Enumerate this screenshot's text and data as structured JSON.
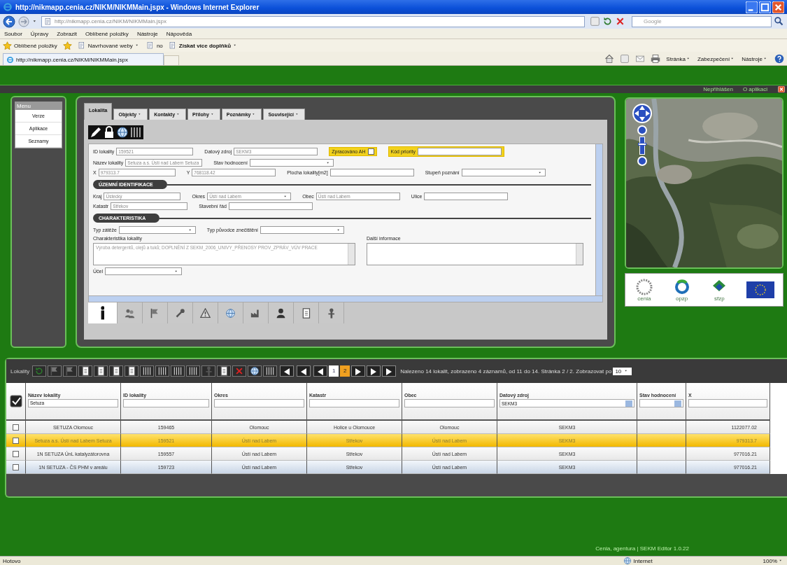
{
  "window": {
    "title": "http://nikmapp.cenia.cz/NIKM/NIKMMain.jspx - Windows Internet Explorer"
  },
  "address_bar": {
    "url": "http://nikmapp.cenia.cz/NIKM/NIKMMain.jspx",
    "search_placeholder": "Google"
  },
  "menu_bar": [
    "Soubor",
    "Úpravy",
    "Zobrazit",
    "Oblíbené položky",
    "Nástroje",
    "Nápověda"
  ],
  "favorites_bar": {
    "label": "Oblíbené položky",
    "items": [
      {
        "label": "Navrhované weby",
        "dropdown": true,
        "bold": false
      },
      {
        "label": "no",
        "dropdown": false,
        "bold": false
      },
      {
        "label": "Získat více doplňků",
        "dropdown": true,
        "bold": true
      }
    ]
  },
  "browser_tab": {
    "title": "http://nikmapp.cenia.cz/NIKM/NIKMMain.jspx"
  },
  "command_bar": [
    "Stránka",
    "Zabezpečení",
    "Nástroje"
  ],
  "app": {
    "header": {
      "user": "Nepřihlášen",
      "link": "O aplikaci"
    },
    "menu": {
      "title": "Menu",
      "items": [
        {
          "label": "Verze",
          "selected": false
        },
        {
          "label": "Aplikace",
          "selected": false
        },
        {
          "label": "Seznamy",
          "selected": false
        }
      ]
    },
    "form": {
      "tabs": [
        {
          "label": "Lokalita",
          "selected": true
        },
        {
          "label": "Objekty",
          "selected": false
        },
        {
          "label": "Kontakty",
          "selected": false
        },
        {
          "label": "Přílohy",
          "selected": false
        },
        {
          "label": "Poznámky",
          "selected": false
        },
        {
          "label": "Související",
          "selected": false
        }
      ],
      "sections": [
        {
          "rows": [
            [
              {
                "kind": "text",
                "label": "ID lokality",
                "value": "159521",
                "highlighted": false
              },
              {
                "kind": "text",
                "label": "Datový zdroj",
                "value": "SEKM3",
                "highlighted": false
              },
              {
                "kind": "checkbox",
                "label": "Zpracováno AH",
                "checked": false,
                "highlighted": true
              },
              {
                "kind": "text",
                "label": "Kód priority",
                "highlighted": true
              }
            ],
            [
              {
                "kind": "text",
                "label": "Název lokality",
                "value": "Setuza a.s. Ústí nad Labem Setuza",
                "highlighted": false
              },
              {
                "kind": "select",
                "label": "Stav hodnocení",
                "highlighted": false
              }
            ],
            [
              {
                "kind": "text",
                "label": "X",
                "value": "979313.7",
                "highlighted": false
              },
              {
                "kind": "text",
                "label": "Y",
                "value": "768118.42",
                "highlighted": false
              },
              {
                "kind": "text",
                "label": "Plocha lokality[m2]",
                "highlighted": false
              },
              {
                "kind": "select",
                "label": "Stupeň poznání",
                "highlighted": false
              }
            ]
          ]
        },
        {
          "title": "ÚZEMNÍ IDENTIFIKACE",
          "rows": [
            [
              {
                "kind": "text",
                "label": "Kraj",
                "value": "Ústecký",
                "highlighted": false
              },
              {
                "kind": "select",
                "label": "Okres",
                "value": "Ústí nad Labem",
                "highlighted": false
              },
              {
                "kind": "text",
                "label": "Obec",
                "value": "Ústí nad Labem",
                "highlighted": false
              },
              {
                "kind": "text",
                "label": "Ulice",
                "highlighted": false
              }
            ],
            [
              {
                "kind": "text",
                "label": "Katastr",
                "value": "Střekov",
                "highlighted": false
              },
              {
                "kind": "text",
                "label": "Stavební řád",
                "highlighted": false
              }
            ]
          ]
        },
        {
          "title": "CHARAKTERISTIKA",
          "rows": [
            [
              {
                "kind": "select",
                "label": "Typ zátěže",
                "highlighted": false
              },
              {
                "kind": "select",
                "label": "Typ původce znečištění",
                "highlighted": false
              }
            ],
            [
              {
                "kind": "textarea",
                "label": "Charakteristika lokality",
                "value": "Výroba detergentů, olejů a tuků; DOPLNĚNÍ Z SEKM_2006_UNIVY_PŘENOSY PROV_ZPRÁV_VÚV PRACE",
                "highlighted": false
              },
              {
                "kind": "textarea",
                "label": "Další informace",
                "highlighted": false
              }
            ],
            [
              {
                "kind": "select",
                "label": "Účel",
                "highlighted": false
              }
            ]
          ]
        }
      ],
      "icon_tabs": [
        {
          "selected": true
        },
        {
          "selected": false
        },
        {
          "selected": false
        },
        {
          "selected": false
        },
        {
          "selected": false
        },
        {
          "selected": false
        },
        {
          "selected": false
        },
        {
          "selected": false
        },
        {
          "selected": false
        },
        {
          "selected": false
        }
      ]
    },
    "logos": [
      {
        "kind": "cenia",
        "caption": "cenia"
      },
      {
        "kind": "ring",
        "caption": "opzp"
      },
      {
        "kind": "diamond",
        "caption": "sfzp"
      },
      {
        "kind": "eu"
      }
    ],
    "map_zoom": {
      "level": 0.6
    },
    "grid": {
      "label": "Lokality",
      "pages": [
        {
          "label": "1",
          "selected": false
        },
        {
          "label": "2",
          "selected": true
        }
      ],
      "pager_text": "Nalezeno 14 lokalit, zobrazeno 4 záznamů, od 11 do 14. Stránka 2 / 2. Zobrazovat po",
      "page_size": "10",
      "header_checked": true,
      "columns": [
        {
          "label": "Název lokality",
          "filter": {
            "kind": "text",
            "value": "Setuza"
          }
        },
        {
          "label": "ID lokality",
          "filter": {
            "kind": "text"
          }
        },
        {
          "label": "Okres",
          "filter": {
            "kind": "text"
          }
        },
        {
          "label": "Katastr",
          "filter": {
            "kind": "text"
          }
        },
        {
          "label": "Obec",
          "filter": {
            "kind": "text"
          }
        },
        {
          "label": "Datový zdroj",
          "filter": {
            "kind": "select",
            "value": "SEKM3"
          }
        },
        {
          "label": "Stav hodnocení",
          "filter": {
            "kind": "select"
          }
        },
        {
          "label": "X",
          "filter": {
            "kind": "text"
          }
        }
      ],
      "rows": [
        {
          "selected": false,
          "checked": false,
          "cells": [
            "SETUZA Olomouc",
            "159465",
            "Olomouc",
            "Holice u Olomouce",
            "Olomouc",
            "SEKM3",
            null,
            "1122077.02"
          ]
        },
        {
          "selected": true,
          "checked": false,
          "cells": [
            "Setuza a.s. Ústí nad Labem Setuza",
            "159521",
            "Ústí nad Labem",
            "Střekov",
            "Ústí nad Labem",
            "SEKM3",
            null,
            "979313.7"
          ]
        },
        {
          "selected": false,
          "checked": false,
          "cells": [
            "1N SETUZA ÚnL katalyzátorovna",
            "159557",
            "Ústí nad Labem",
            "Střekov",
            "Ústí nad Labem",
            "SEKM3",
            null,
            "977016.21"
          ]
        },
        {
          "selected": false,
          "checked": false,
          "cells": [
            "1N SETUZA - ČS PHM v areálu",
            "159723",
            "Ústí nad Labem",
            "Střekov",
            "Ústí nad Labem",
            "SEKM3",
            null,
            "977016.21"
          ]
        }
      ]
    },
    "footer": "Cenia, agentura | SEKM Editor 1.0.22"
  },
  "status_bar": {
    "text": "Hotovo",
    "zone": "Internet",
    "zoom": "100%"
  }
}
